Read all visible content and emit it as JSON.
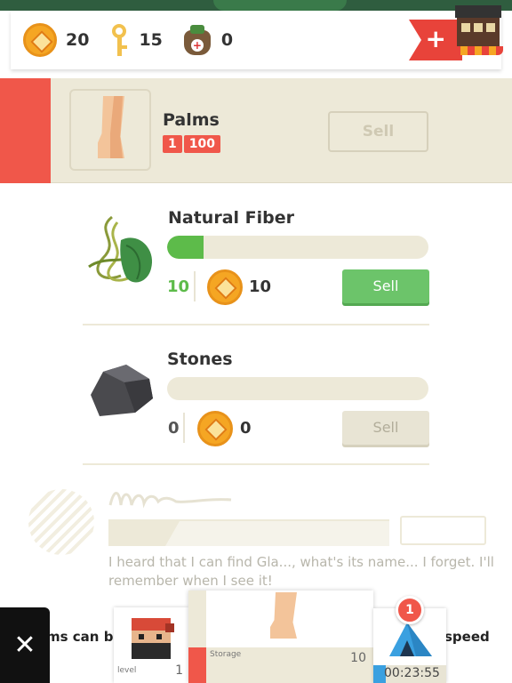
{
  "resources": {
    "coins": "20",
    "keys": "15",
    "kits": "0"
  },
  "shop": {
    "plus": "+"
  },
  "palms": {
    "name": "Palms",
    "badge_a": "1",
    "badge_b": "100",
    "sell_label": "Sell"
  },
  "items": [
    {
      "name": "Natural Fiber",
      "progress": 0.14,
      "count": "10",
      "price": "10",
      "sell_label": "Sell"
    },
    {
      "name": "Stones",
      "progress": 0,
      "count": "0",
      "price": "0",
      "sell_label": "Sell"
    }
  ],
  "quest": {
    "text": "I heard that I can find Gla..., what's its name... I forget. I'll remember when I see it!"
  },
  "dock": {
    "close": "✕",
    "left_text": "ms can be",
    "right_text": "speed",
    "level_label": "level",
    "level_value": "1",
    "storage_label": "Storage",
    "storage_value": "10",
    "timer": "00:23:55",
    "notification": "1"
  },
  "colors": {
    "accent_red": "#f0574a",
    "green": "#5dbb4a",
    "coin": "#f5a623",
    "beige": "#ede9d8"
  }
}
